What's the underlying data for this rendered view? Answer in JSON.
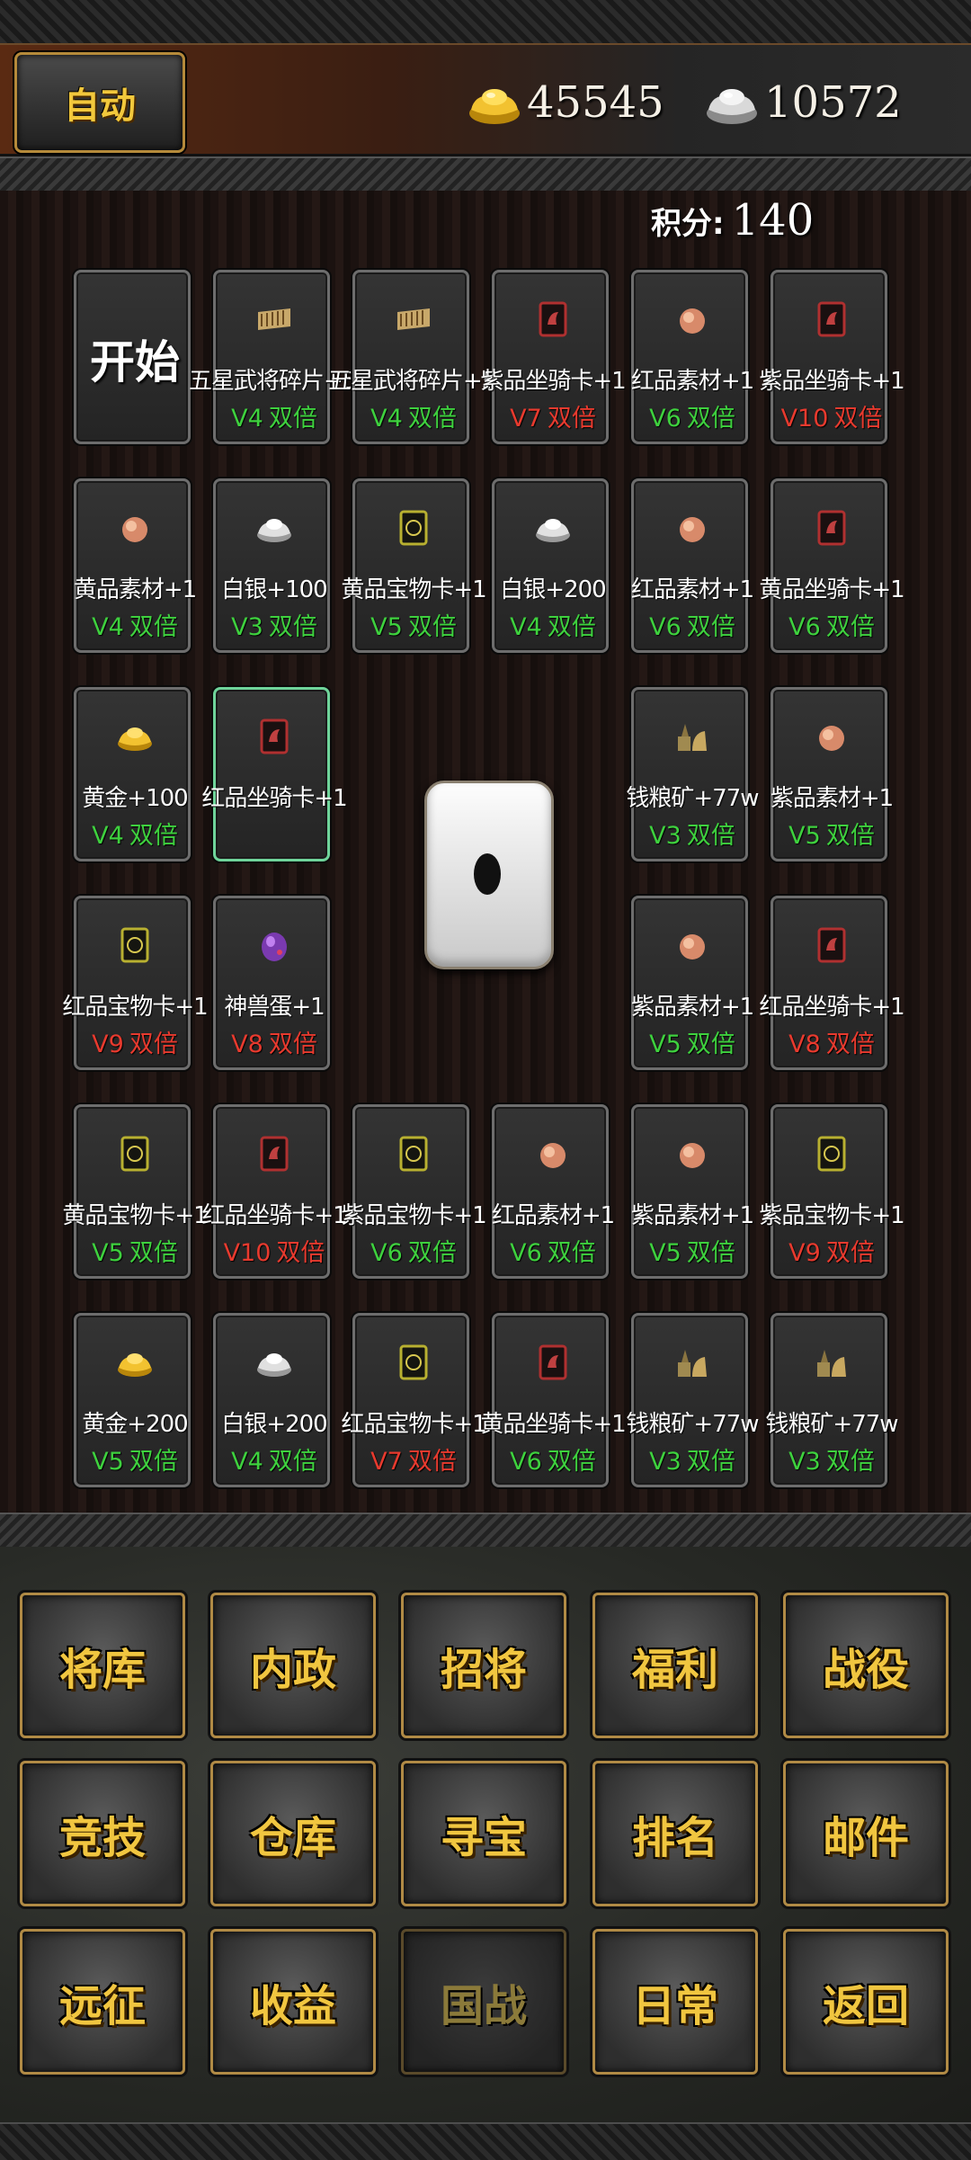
{
  "header": {
    "auto_label": "自动",
    "gold": "45545",
    "silver": "10572",
    "score_label": "积分:",
    "score_value": "140"
  },
  "board": {
    "start_label": "开始",
    "dice_value": 1,
    "cells": [
      {
        "name": "五星武将碎片+50",
        "level": "V4",
        "double": "双倍",
        "level_color": "#3ed13e",
        "icon": "fragment-icon"
      },
      {
        "name": "五星武将碎片+50",
        "level": "V4",
        "double": "双倍",
        "level_color": "#3ed13e",
        "icon": "fragment-icon"
      },
      {
        "name": "紫品坐骑卡+1",
        "level": "V7",
        "double": "双倍",
        "level_color": "#e83a2e",
        "icon": "mount-card-icon"
      },
      {
        "name": "红品素材+1",
        "level": "V6",
        "double": "双倍",
        "level_color": "#3ed13e",
        "icon": "material-icon"
      },
      {
        "name": "紫品坐骑卡+1",
        "level": "V10",
        "double": "双倍",
        "level_color": "#e83a2e",
        "icon": "mount-card-icon"
      },
      {
        "name": "黄品素材+1",
        "level": "V4",
        "double": "双倍",
        "level_color": "#3ed13e",
        "icon": "material-icon"
      },
      {
        "name": "白银+100",
        "level": "V3",
        "double": "双倍",
        "level_color": "#3ed13e",
        "icon": "silver-icon"
      },
      {
        "name": "黄品宝物卡+1",
        "level": "V5",
        "double": "双倍",
        "level_color": "#3ed13e",
        "icon": "treasure-card-icon"
      },
      {
        "name": "白银+200",
        "level": "V4",
        "double": "双倍",
        "level_color": "#3ed13e",
        "icon": "silver-icon"
      },
      {
        "name": "红品素材+1",
        "level": "V6",
        "double": "双倍",
        "level_color": "#3ed13e",
        "icon": "material-icon"
      },
      {
        "name": "黄品坐骑卡+1",
        "level": "V6",
        "double": "双倍",
        "level_color": "#3ed13e",
        "icon": "mount-card-icon"
      },
      {
        "name": "黄金+100",
        "level": "V4",
        "double": "双倍",
        "level_color": "#3ed13e",
        "icon": "gold-icon"
      },
      {
        "name": "红品坐骑卡+1",
        "level": "",
        "double": "",
        "level_color": "#3ed13e",
        "icon": "mount-card-icon"
      },
      {
        "name": "钱粮矿+77w",
        "level": "V3",
        "double": "双倍",
        "level_color": "#3ed13e",
        "icon": "ore-icon"
      },
      {
        "name": "紫品素材+1",
        "level": "V5",
        "double": "双倍",
        "level_color": "#3ed13e",
        "icon": "material-icon"
      },
      {
        "name": "红品宝物卡+1",
        "level": "V9",
        "double": "双倍",
        "level_color": "#e83a2e",
        "icon": "treasure-card-icon"
      },
      {
        "name": "神兽蛋+1",
        "level": "V8",
        "double": "双倍",
        "level_color": "#e83a2e",
        "icon": "beast-egg-icon"
      },
      {
        "name": "紫品素材+1",
        "level": "V5",
        "double": "双倍",
        "level_color": "#3ed13e",
        "icon": "material-icon"
      },
      {
        "name": "红品坐骑卡+1",
        "level": "V8",
        "double": "双倍",
        "level_color": "#e83a2e",
        "icon": "mount-card-icon"
      },
      {
        "name": "黄品宝物卡+1",
        "level": "V5",
        "double": "双倍",
        "level_color": "#3ed13e",
        "icon": "treasure-card-icon"
      },
      {
        "name": "红品坐骑卡+1",
        "level": "V10",
        "double": "双倍",
        "level_color": "#e83a2e",
        "icon": "mount-card-icon"
      },
      {
        "name": "紫品宝物卡+1",
        "level": "V6",
        "double": "双倍",
        "level_color": "#3ed13e",
        "icon": "treasure-card-icon"
      },
      {
        "name": "红品素材+1",
        "level": "V6",
        "double": "双倍",
        "level_color": "#3ed13e",
        "icon": "material-icon"
      },
      {
        "name": "紫品素材+1",
        "level": "V5",
        "double": "双倍",
        "level_color": "#3ed13e",
        "icon": "material-icon"
      },
      {
        "name": "紫品宝物卡+1",
        "level": "V9",
        "double": "双倍",
        "level_color": "#e83a2e",
        "icon": "treasure-card-icon"
      },
      {
        "name": "黄金+200",
        "level": "V5",
        "double": "双倍",
        "level_color": "#3ed13e",
        "icon": "gold-icon"
      },
      {
        "name": "白银+200",
        "level": "V4",
        "double": "双倍",
        "level_color": "#3ed13e",
        "icon": "silver-icon"
      },
      {
        "name": "红品宝物卡+1",
        "level": "V7",
        "double": "双倍",
        "level_color": "#e83a2e",
        "icon": "treasure-card-icon"
      },
      {
        "name": "黄品坐骑卡+1",
        "level": "V6",
        "double": "双倍",
        "level_color": "#3ed13e",
        "icon": "mount-card-icon"
      },
      {
        "name": "钱粮矿+77w",
        "level": "V3",
        "double": "双倍",
        "level_color": "#3ed13e",
        "icon": "ore-icon"
      },
      {
        "name": "钱粮矿+77w",
        "level": "V3",
        "double": "双倍",
        "level_color": "#3ed13e",
        "icon": "ore-icon"
      }
    ]
  },
  "menu": [
    {
      "label": "将库",
      "id": "generals"
    },
    {
      "label": "内政",
      "id": "internal-affairs"
    },
    {
      "label": "招将",
      "id": "recruit"
    },
    {
      "label": "福利",
      "id": "welfare"
    },
    {
      "label": "战役",
      "id": "campaign"
    },
    {
      "label": "竞技",
      "id": "arena"
    },
    {
      "label": "仓库",
      "id": "warehouse"
    },
    {
      "label": "寻宝",
      "id": "treasure-hunt"
    },
    {
      "label": "排名",
      "id": "ranking"
    },
    {
      "label": "邮件",
      "id": "mail"
    },
    {
      "label": "远征",
      "id": "expedition"
    },
    {
      "label": "收益",
      "id": "income"
    },
    {
      "label": "国战",
      "id": "national-war"
    },
    {
      "label": "日常",
      "id": "daily"
    },
    {
      "label": "返回",
      "id": "back"
    }
  ],
  "colors": {
    "accent_gold": "#f1c640",
    "double_green": "#3ed13e",
    "double_red": "#e83a2e",
    "selected_border": "#6fd49a"
  }
}
